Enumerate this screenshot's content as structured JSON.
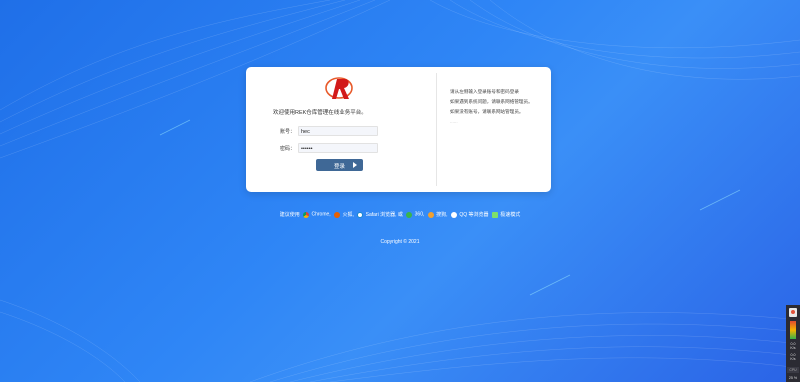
{
  "login": {
    "welcome": "欢迎使用REK仓库管理在线业务平台。",
    "username_label": "账号：",
    "username_value": "hec",
    "password_label": "密码：",
    "password_value": "••••••",
    "submit_label": "登录"
  },
  "help": {
    "line1": "请从左侧输入登录账号和密码登录",
    "line2": "如果遇到系统问题，请联系网络管理员。",
    "line3": "如果没有账号，请联系网站管理员。",
    "line4": "......"
  },
  "browsers": {
    "prefix": "建议使用",
    "chrome": "Chrome,",
    "firefox": "火狐,",
    "safari": "Safari 浏览器,",
    "or": "或",
    "b360": "360,",
    "sogou": "搜狗,",
    "qq": "QQ 等浏览器",
    "speed": "极速模式"
  },
  "footer": {
    "copyright": "Copyright © 2021"
  },
  "tray": {
    "up_value": "0.0",
    "up_unit": "K/s",
    "down_value": "0.0",
    "down_unit": "K/s",
    "cpu_label": "CPU",
    "percent": "25 %"
  },
  "colors": {
    "background": "#2f86f6",
    "button": "#3f6896",
    "logo": "#d21a1a"
  }
}
